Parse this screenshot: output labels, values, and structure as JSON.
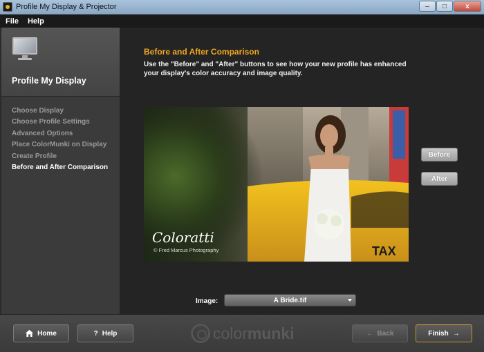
{
  "window": {
    "title": "Profile My Display & Projector",
    "controls": [
      "–",
      "□",
      "x"
    ]
  },
  "menu": [
    "File",
    "Help"
  ],
  "sidebar": {
    "title": "Profile My Display",
    "steps": [
      {
        "label": "Choose Display",
        "active": false
      },
      {
        "label": "Choose Profile Settings",
        "active": false
      },
      {
        "label": "Advanced Options",
        "active": false
      },
      {
        "label": "Place ColorMunki on Display",
        "active": false
      },
      {
        "label": "Create Profile",
        "active": false
      },
      {
        "label": "Before and After Comparison",
        "active": true
      }
    ]
  },
  "main": {
    "heading": "Before and After Comparison",
    "description": "Use the \"Before\" and \"After\" buttons to see how your new profile has enhanced your display's color accuracy and image quality.",
    "photo": {
      "logo": "Coloratti",
      "credit": "© Fred Marcus Photography",
      "taxi_text": "TAX"
    },
    "before_label": "Before",
    "after_label": "After",
    "image_label": "Image:",
    "image_value": "A Bride.tif"
  },
  "footer": {
    "home_label": "Home",
    "help_label": "Help",
    "back_label": "Back",
    "finish_label": "Finish",
    "brand_light": "color",
    "brand_bold": "munki"
  },
  "colors": {
    "accent": "#f0a820",
    "sidebar_bg": "#3b3b3b",
    "main_bg": "#242424"
  }
}
